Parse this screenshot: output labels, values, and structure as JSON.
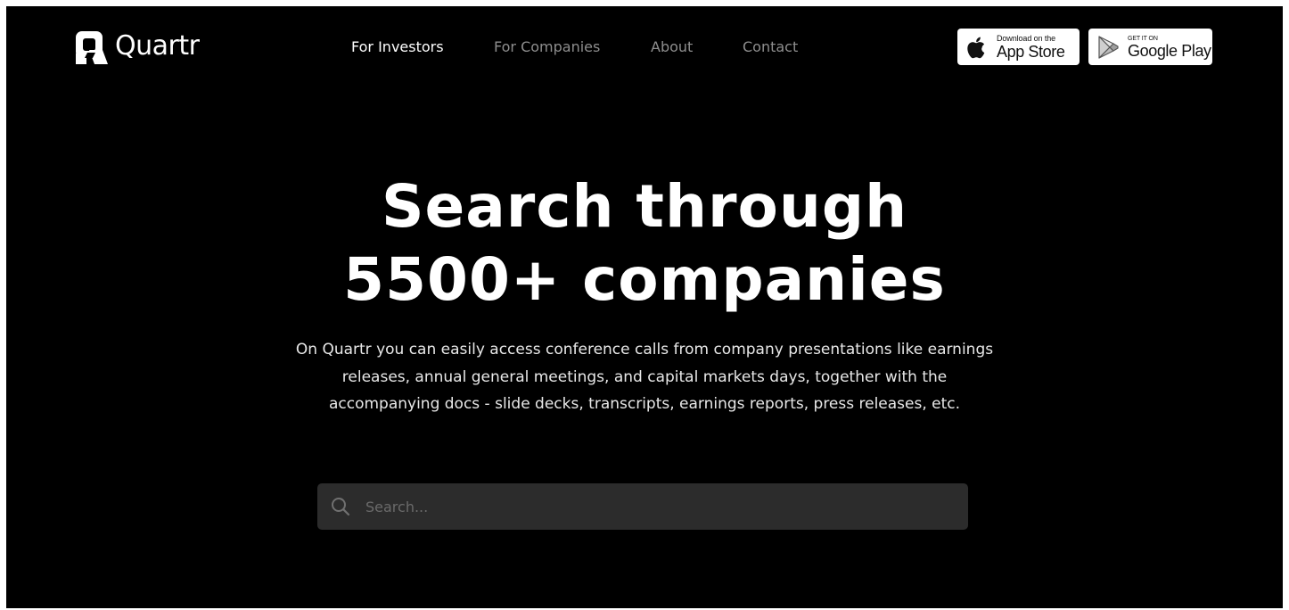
{
  "brand": {
    "name": "Quartr",
    "logo_icon": "quartr-q-logo-icon"
  },
  "nav": {
    "items": [
      {
        "label": "For Investors",
        "active": true
      },
      {
        "label": "For Companies",
        "active": false
      },
      {
        "label": "About",
        "active": false
      },
      {
        "label": "Contact",
        "active": false
      }
    ]
  },
  "badges": {
    "app_store": {
      "icon": "apple-icon",
      "small": "Download on the",
      "big": "App Store"
    },
    "google_play": {
      "icon": "google-play-icon",
      "small": "GET IT ON",
      "big": "Google Play"
    }
  },
  "hero": {
    "title_line1": "Search through",
    "title_line2": "5500+ companies",
    "description": "On Quartr you can easily access conference calls from company presentations like earnings releases, annual general meetings, and capital markets days, together with the accompanying docs - slide decks, transcripts, earnings reports, press releases, etc."
  },
  "search": {
    "placeholder": "Search...",
    "value": "",
    "icon": "search-icon"
  },
  "colors": {
    "background": "#000000",
    "text": "#ffffff",
    "nav_inactive": "#8e8e8e",
    "search_bg": "#2c2c2c"
  }
}
